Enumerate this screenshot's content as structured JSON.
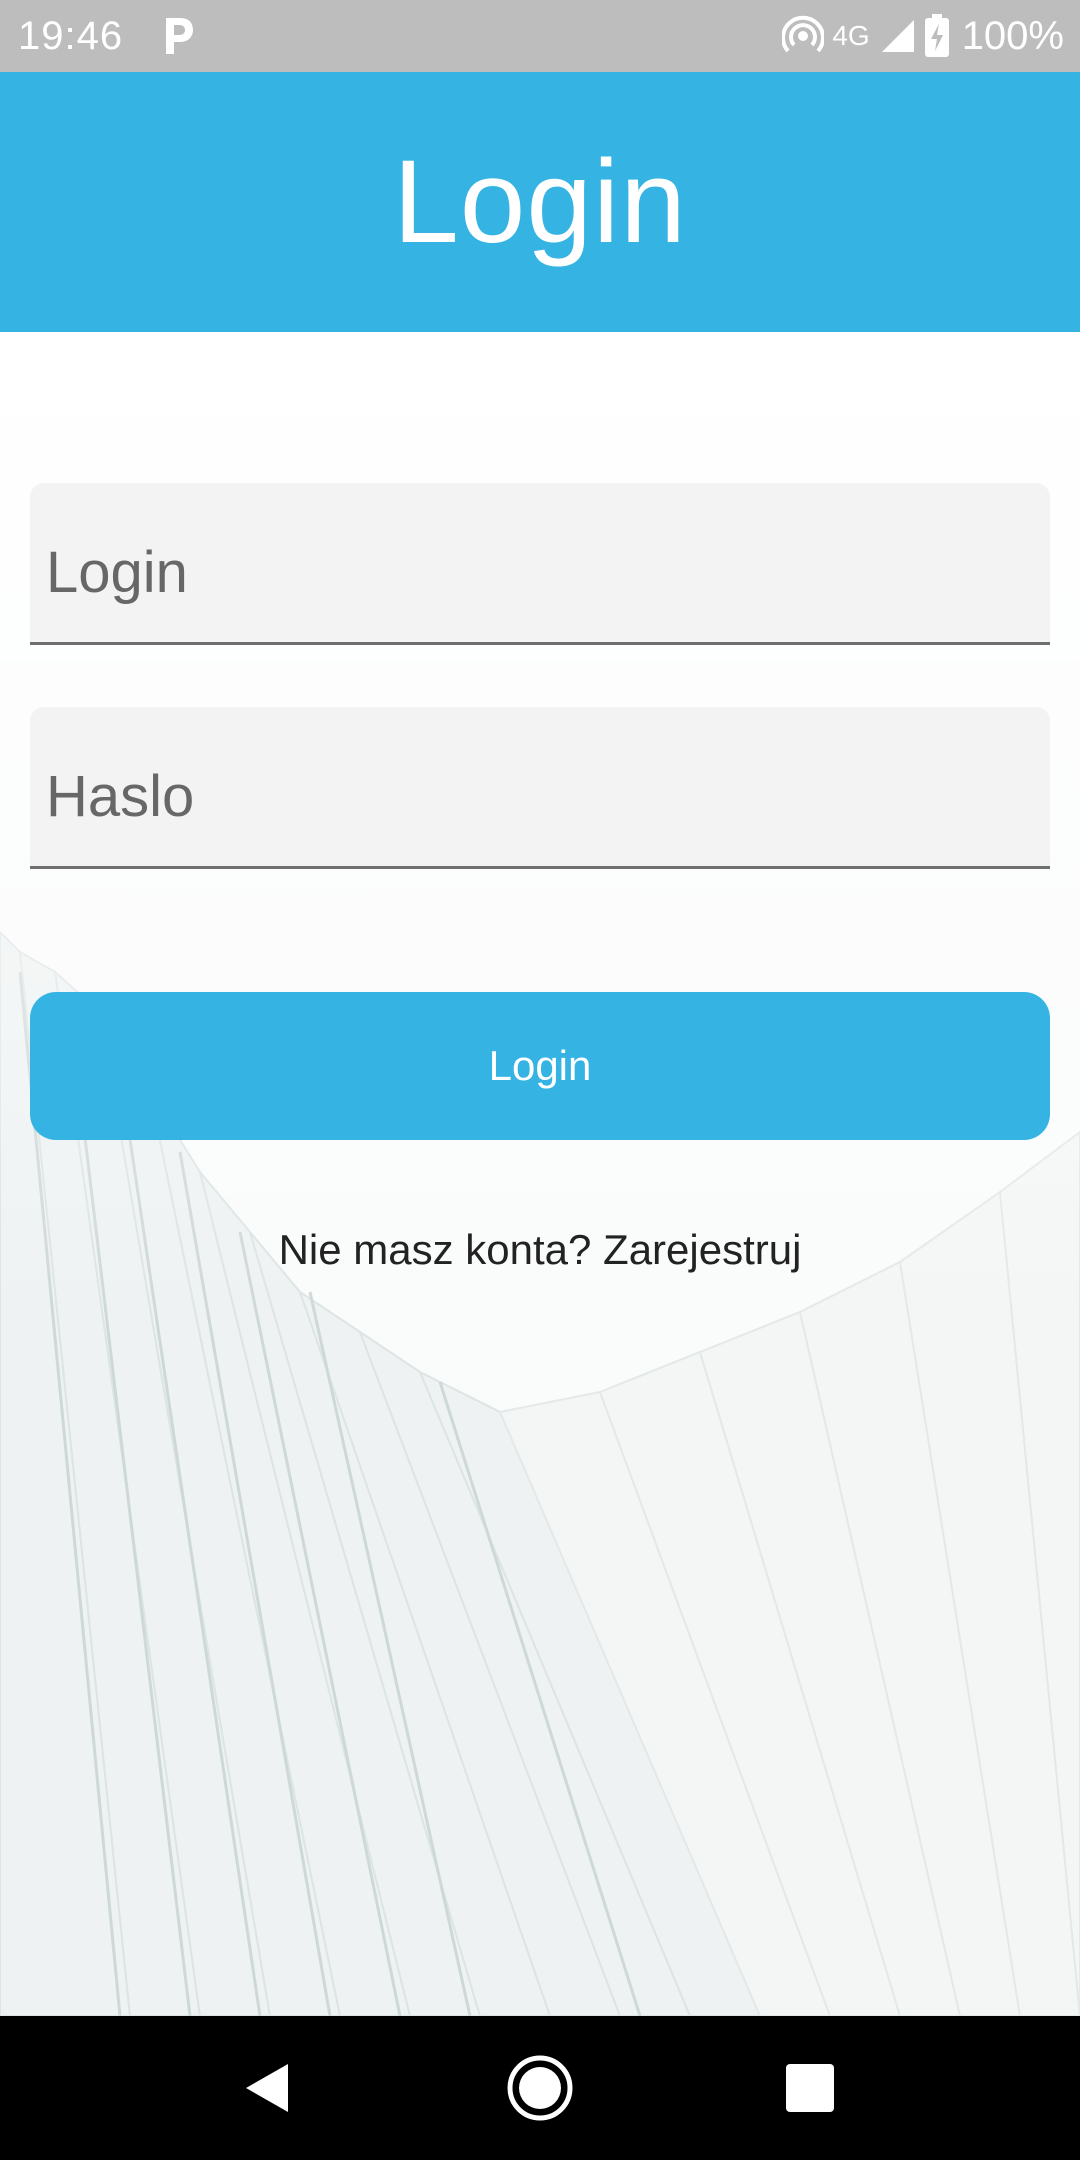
{
  "status_bar": {
    "time": "19:46",
    "app_icon": "parking-p-icon",
    "network_type": "4G",
    "battery_percent": "100%",
    "icons": [
      "hotspot-icon",
      "signal-icon",
      "battery-charging-icon"
    ]
  },
  "app_bar": {
    "title": "Login",
    "color": "#35b4e4"
  },
  "form": {
    "login_placeholder": "Login",
    "login_value": "",
    "password_placeholder": "Haslo",
    "password_value": "",
    "submit_label": "Login",
    "register_text": "Nie masz konta? Zarejestruj"
  },
  "nav_bar": {
    "icons": [
      "back-icon",
      "home-icon",
      "recents-icon"
    ]
  },
  "colors": {
    "accent": "#35b4e4",
    "status_bar": "#bdbdbd",
    "field_bg": "#f3f3f3",
    "text": "#222222"
  }
}
